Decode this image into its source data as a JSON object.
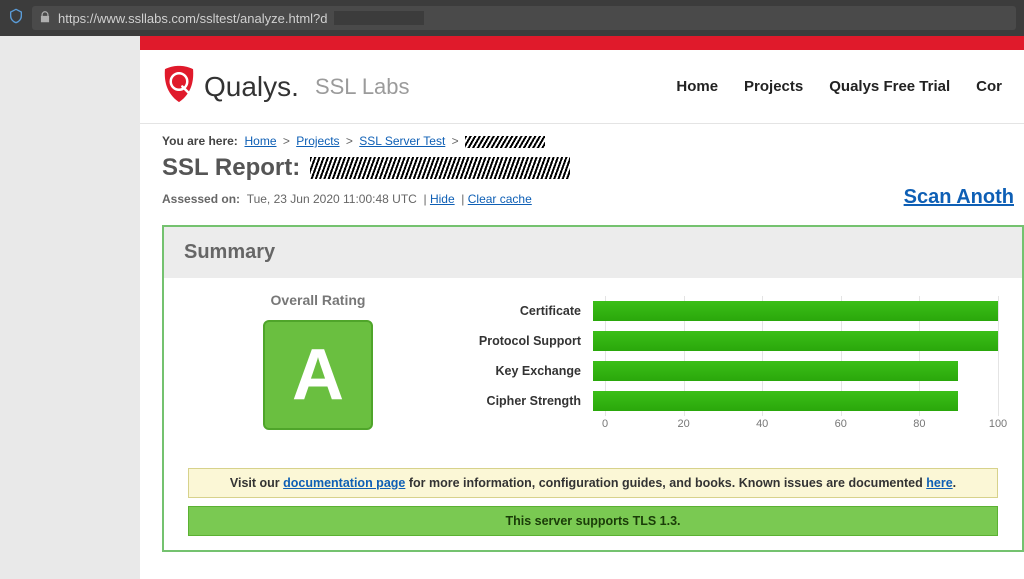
{
  "browser": {
    "url": "https://www.ssllabs.com/ssltest/analyze.html?d"
  },
  "brand": {
    "name": "Qualys.",
    "sub": "SSL Labs"
  },
  "nav": {
    "home": "Home",
    "projects": "Projects",
    "trial": "Qualys Free Trial",
    "contact": "Cor"
  },
  "crumbs": {
    "label": "You are here:",
    "home": "Home",
    "projects": "Projects",
    "ssltest": "SSL Server Test"
  },
  "title": "SSL Report:",
  "meta": {
    "assessed_label": "Assessed on:",
    "assessed_value": "Tue, 23 Jun 2020 11:00:48 UTC",
    "hide": "Hide",
    "clear": "Clear cache",
    "scan": "Scan Anoth"
  },
  "summary": {
    "heading": "Summary",
    "rating_label": "Overall Rating",
    "rating_grade": "A",
    "doc_pre": "Visit our ",
    "doc_link": "documentation page",
    "doc_mid": " for more information, configuration guides, and books. Known issues are documented ",
    "doc_here": "here",
    "doc_post": ".",
    "tls": "This server supports TLS 1.3."
  },
  "chart_data": {
    "type": "bar",
    "categories": [
      "Certificate",
      "Protocol Support",
      "Key Exchange",
      "Cipher Strength"
    ],
    "values": [
      100,
      100,
      90,
      90
    ],
    "xlabel": "",
    "ylabel": "",
    "ylim": [
      0,
      100
    ],
    "ticks": [
      0,
      20,
      40,
      60,
      80,
      100
    ]
  }
}
